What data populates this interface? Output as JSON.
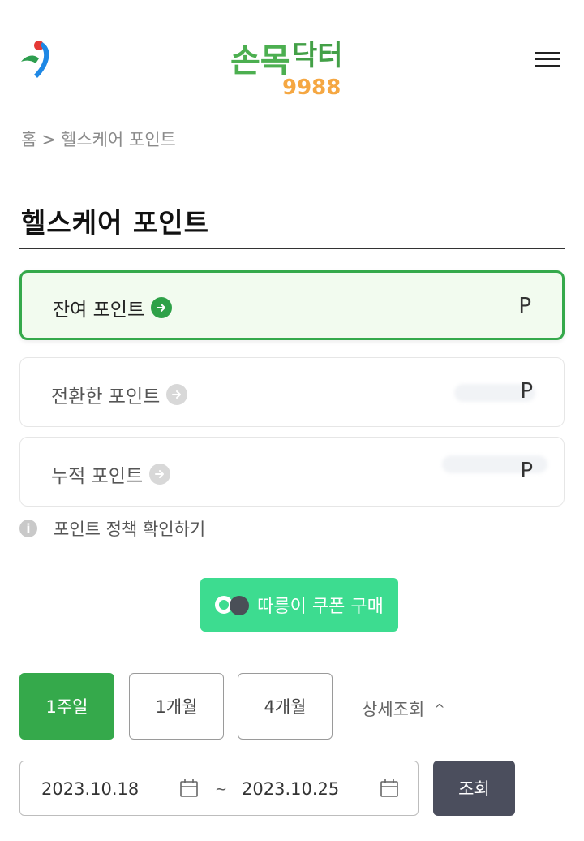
{
  "header": {
    "city_logo": "seoul-city-logo",
    "brand_logo_text": "손목닥터9988",
    "menu_icon": "hamburger-menu-icon"
  },
  "breadcrumb": {
    "home": "홈",
    "separator": ">",
    "current": "헬스케어 포인트"
  },
  "page": {
    "title": "헬스케어 포인트"
  },
  "points": [
    {
      "label": "잔여 포인트",
      "unit": "P",
      "active": true
    },
    {
      "label": "전환한 포인트",
      "unit": "P",
      "active": false
    },
    {
      "label": "누적 포인트",
      "unit": "P",
      "active": false
    }
  ],
  "policy": {
    "icon": "i",
    "text": "포인트 정책 확인하기"
  },
  "coupon_button": {
    "label": "따릉이 쿠폰 구매"
  },
  "period": {
    "options": [
      "1주일",
      "1개월",
      "4개월"
    ],
    "selected": "1주일",
    "detail_label": "상세조회",
    "detail_caret": "^"
  },
  "date_range": {
    "start": "2023.10.18",
    "separator": "~",
    "end": "2023.10.25",
    "search_label": "조회"
  },
  "colors": {
    "accent_green": "#35a94b",
    "coupon_green": "#3ddc90",
    "search_button": "#4b4e5d"
  }
}
